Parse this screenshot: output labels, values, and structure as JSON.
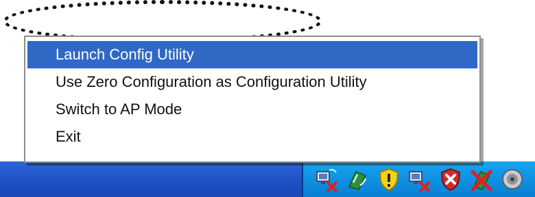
{
  "menu": {
    "items": [
      {
        "label": "Launch Config Utility",
        "selected": true
      },
      {
        "label": "Use Zero Configuration as Configuration Utility",
        "selected": false
      },
      {
        "label": "Switch to AP Mode",
        "selected": false
      },
      {
        "label": "Exit",
        "selected": false
      }
    ]
  },
  "colors": {
    "menu_highlight": "#3068c6",
    "taskbar": "#2a5fd6",
    "tray": "#0f8ee0"
  },
  "tray": {
    "icons": [
      "network-disconnected-icon",
      "wireless-utility-icon",
      "security-shield-icon",
      "network-disconnected-icon",
      "security-alert-icon",
      "wireless-disabled-icon",
      "speaker-volume-icon"
    ]
  }
}
